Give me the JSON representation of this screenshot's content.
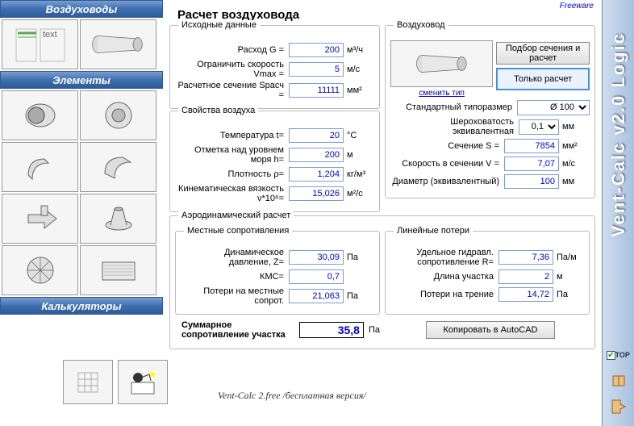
{
  "freeware": "Freeware",
  "app_title": "Vent-Calc v2.0 Logic",
  "top_checkbox": "TOP",
  "sections": {
    "ducts": "Воздуховоды",
    "elements": "Элементы",
    "calculators": "Калькуляторы"
  },
  "main": {
    "title": "Расчет воздуховода",
    "input_data": {
      "legend": "Исходные данные",
      "flow_label": "Расход G =",
      "flow_val": "200",
      "flow_unit": "м³/ч",
      "vmax_label": "Ограничить скорость Vmax =",
      "vmax_val": "5",
      "vmax_unit": "м/с",
      "section_label": "Расчетное сечение Sрасч =",
      "section_val": "11111",
      "section_unit": "мм²"
    },
    "duct": {
      "legend": "Воздуховод",
      "change_type": "сменить тип",
      "btn_select": "Подбор сечения и расчет",
      "btn_calc": "Только расчет",
      "size_label": "Стандартный типоразмер",
      "size_val": "Ø 100",
      "rough_label": "Шероховатость эквивалентная",
      "rough_val": "0,1",
      "rough_unit": "мм",
      "s_label": "Сечение S =",
      "s_val": "7854",
      "s_unit": "мм²",
      "v_label": "Скорость в сечении V =",
      "v_val": "7,07",
      "v_unit": "м/с",
      "d_label": "Диаметр (эквивалентный)",
      "d_val": "100",
      "d_unit": "мм"
    },
    "air": {
      "legend": "Свойства воздуха",
      "t_label": "Температура t=",
      "t_val": "20",
      "t_unit": "°C",
      "h_label": "Отметка над уровнем моря h=",
      "h_val": "200",
      "h_unit": "м",
      "rho_label": "Плотность ρ=",
      "rho_val": "1,204",
      "rho_unit": "кг/м³",
      "nu_label": "Кинематическая вязкость ν*10⁶=",
      "nu_val": "15,026",
      "nu_unit": "м²/с"
    },
    "aero": {
      "legend": "Аэродинамический расчет",
      "local": {
        "legend": "Местные сопротивления",
        "z_label": "Динамическое давление, Z=",
        "z_val": "30,09",
        "z_unit": "Па",
        "kmc_label": "КМС=",
        "kmc_val": "0,7",
        "loss_label": "Потери на местные сопрот.",
        "loss_val": "21,063",
        "loss_unit": "Па"
      },
      "linear": {
        "legend": "Линейные потери",
        "r_label": "Удельное гидравл. сопротивление R=",
        "r_val": "7,36",
        "r_unit": "Па/м",
        "l_label": "Длина участка",
        "l_val": "2",
        "l_unit": "м",
        "f_label": "Потери на трение",
        "f_val": "14,72",
        "f_unit": "Па"
      }
    },
    "sum": {
      "label": "Суммарное сопротивление участка",
      "val": "35,8",
      "unit": "Па"
    },
    "copy_btn": "Копировать в AutoCAD"
  },
  "footer": "Vent-Calc 2.free /бесплатная версия/"
}
